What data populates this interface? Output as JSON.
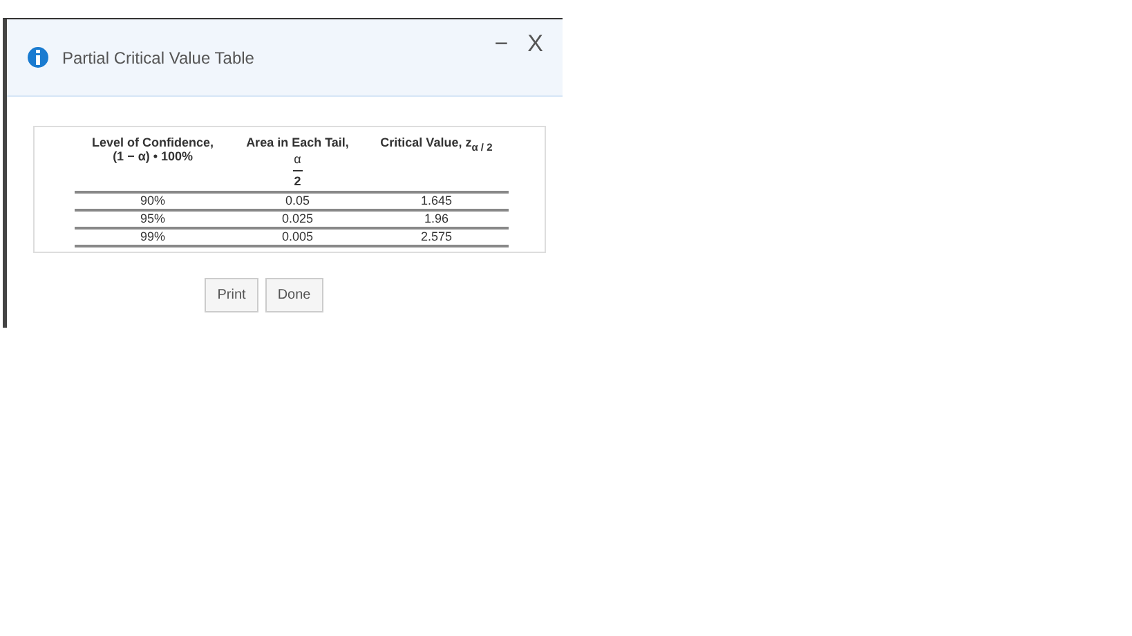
{
  "dialog": {
    "title": "Partial Critical Value Table",
    "minimize": "−",
    "close": "X"
  },
  "table": {
    "columns": [
      {
        "label": "Level of Confidence,",
        "sub": "(1 − α) • 100%"
      },
      {
        "label": "Area in Each Tail,",
        "numerator": "α",
        "denominator": "2"
      },
      {
        "label": "Critical Value, z$_{α / 2}$"
      }
    ],
    "rows": [
      [
        "90%",
        "0.05",
        "1.645"
      ],
      [
        "95%",
        "0.025",
        "1.96"
      ],
      [
        "99%",
        "0.005",
        "2.575"
      ]
    ]
  },
  "buttons": [
    "Print",
    "Done"
  ]
}
